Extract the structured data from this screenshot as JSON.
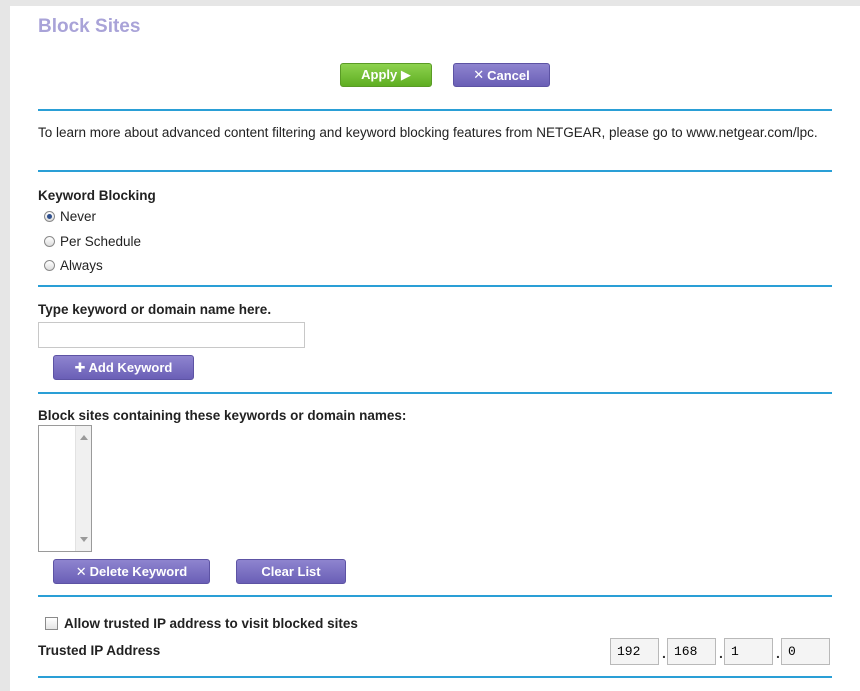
{
  "page": {
    "title": "Block Sites"
  },
  "toolbar": {
    "apply_label": "Apply ▶",
    "cancel_label": "Cancel"
  },
  "info": {
    "text": "To learn more about advanced content filtering and keyword blocking features from NETGEAR, please go to www.netgear.com/lpc."
  },
  "keyword_blocking": {
    "label": "Keyword Blocking",
    "options": [
      "Never",
      "Per Schedule",
      "Always"
    ],
    "selected": "Never"
  },
  "keyword_input": {
    "label": "Type keyword or domain name here.",
    "value": "",
    "add_label": "Add Keyword"
  },
  "block_list": {
    "label": "Block sites containing these keywords or domain names:",
    "items": [],
    "delete_label": "Delete Keyword",
    "clear_label": "Clear List"
  },
  "trusted": {
    "checkbox_label": "Allow trusted IP address to visit blocked sites",
    "checked": false,
    "ip_label": "Trusted IP Address",
    "ip": [
      "192",
      "168",
      "1",
      "0"
    ]
  },
  "colors": {
    "accent": "#2a9fd6",
    "title": "#a9a3d8",
    "apply": "#6dbb2e",
    "purple": "#7469c2"
  },
  "icons": {
    "cancel": "close-icon",
    "add": "plus-icon",
    "delete": "close-icon",
    "apply": "play-icon"
  }
}
